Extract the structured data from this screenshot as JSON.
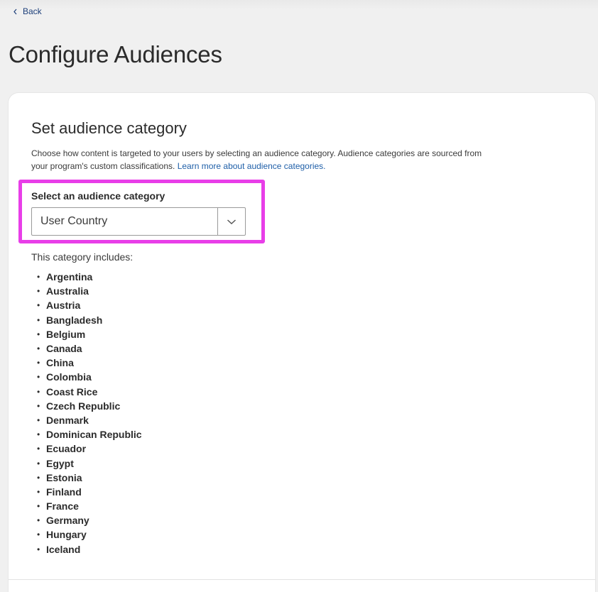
{
  "nav": {
    "back_label": "Back"
  },
  "page_title": "Configure Audiences",
  "section": {
    "title": "Set audience category",
    "description": "Choose how content is targeted to your users by selecting an audience category. Audience categories are sourced from your program's custom classifications.",
    "learn_more_link": "Learn more about audience categories."
  },
  "audience_select": {
    "label": "Select an audience category",
    "selected_value": "User Country"
  },
  "includes": {
    "label": "This category includes:",
    "countries": [
      "Argentina",
      "Australia",
      "Austria",
      "Bangladesh",
      "Belgium",
      "Canada",
      "China",
      "Colombia",
      "Coast Rice",
      "Czech Republic",
      "Denmark",
      "Dominican Republic",
      "Ecuador",
      "Egypt",
      "Estonia",
      "Finland",
      "France",
      "Germany",
      "Hungary",
      "Iceland"
    ]
  },
  "colors": {
    "link": "#1f5fa8",
    "highlight": "#e83ee8",
    "back_link": "#1d3f7a"
  },
  "icons": {
    "back": "chevron-left-icon",
    "select_toggle": "chevron-down-icon"
  }
}
